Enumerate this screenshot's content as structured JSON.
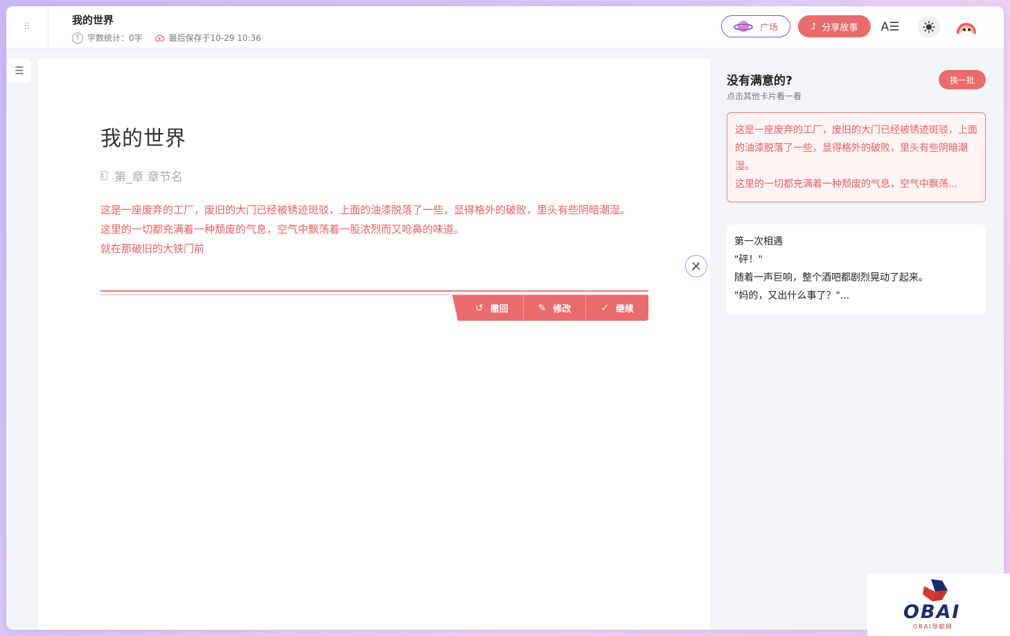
{
  "header": {
    "title": "我的世界",
    "word_count": "字数统计：0字",
    "last_saved": "最后保存于10-29 10:36",
    "plaza_label": "广场",
    "share_label": "分享故事"
  },
  "editor": {
    "chapter_title": "我的世界",
    "section_placeholder": "第_章 章节名",
    "paragraphs": [
      "这是一座废弃的工厂，废旧的大门已经被锈迹斑驳，上面的油漆脱落了一些，显得格外的破败，里头有些阴暗潮湿。",
      "这里的一切都充满着一种颓废的气息，空气中飘荡着一股浓烈而又呛鼻的味道。",
      "就在那破旧的大铁门前"
    ],
    "actions": {
      "undo": "撤回",
      "modify": "修改",
      "continue": "继续"
    }
  },
  "panel": {
    "title": "没有满意的?",
    "subtitle": "点击其他卡片看一看",
    "refresh_label": "换一批",
    "cards": [
      {
        "lines": [
          "这是一座废弃的工厂，废旧的大门已经被锈迹斑驳，上面的油漆脱落了一些，显得格外的破败，里头有些阴暗潮湿。",
          "这里的一切都充满着一种颓废的气息，空气中飘荡..."
        ]
      },
      {
        "lines": [
          "第一次相遇",
          "\"砰！\"",
          "随着一声巨响，整个酒吧都剧烈晃动了起来。",
          "\"妈的，又出什么事了？\"..."
        ]
      }
    ]
  },
  "watermark": {
    "logo_text": "OBAI",
    "small_text": "OBAI导航网"
  },
  "colors": {
    "accent": "#ea6b6b",
    "accent_text": "#e46060",
    "purple_border": "#6b55e6"
  }
}
